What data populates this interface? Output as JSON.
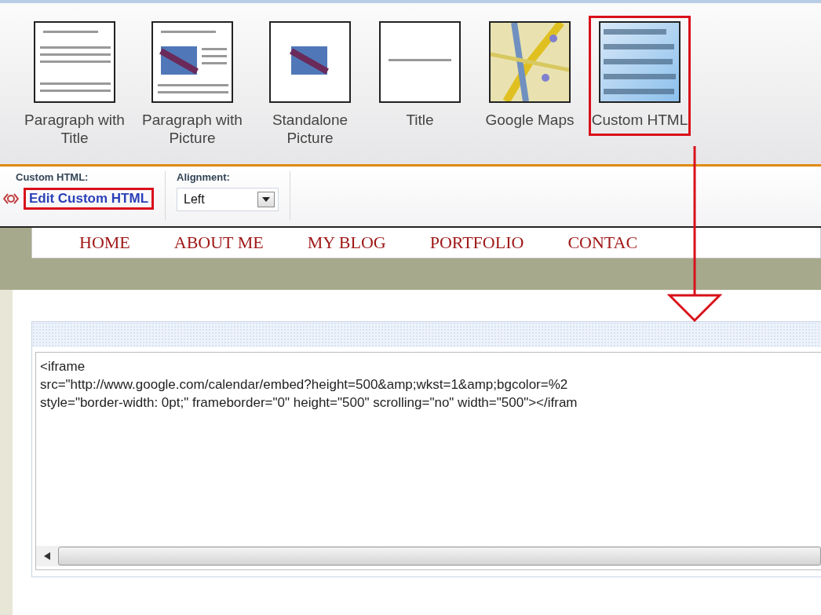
{
  "ribbon": {
    "items": [
      {
        "label": "Paragraph with Title",
        "kind": "paragraph-title",
        "selected": false
      },
      {
        "label": "Paragraph with Picture",
        "kind": "paragraph-picture",
        "selected": false
      },
      {
        "label": "Standalone Picture",
        "kind": "picture",
        "selected": false
      },
      {
        "label": "Title",
        "kind": "title",
        "selected": false
      },
      {
        "label": "Google Maps",
        "kind": "map",
        "selected": false
      },
      {
        "label": "Custom HTML",
        "kind": "code",
        "selected": true
      }
    ]
  },
  "toolbar": {
    "section_label": "Custom HTML:",
    "link": "Edit Custom HTML",
    "alignment": {
      "label": "Alignment:",
      "value": "Left"
    }
  },
  "nav": [
    "HOME",
    "ABOUT ME",
    "MY BLOG",
    "PORTFOLIO",
    "CONTAC"
  ],
  "editor": {
    "lines": [
      "<iframe",
      "src=\"http://www.google.com/calendar/embed?height=500&amp;wkst=1&amp;bgcolor=%2",
      "style=\"border-width: 0pt;\" frameborder=\"0\" height=\"500\" scrolling=\"no\" width=\"500\"></ifram"
    ]
  }
}
